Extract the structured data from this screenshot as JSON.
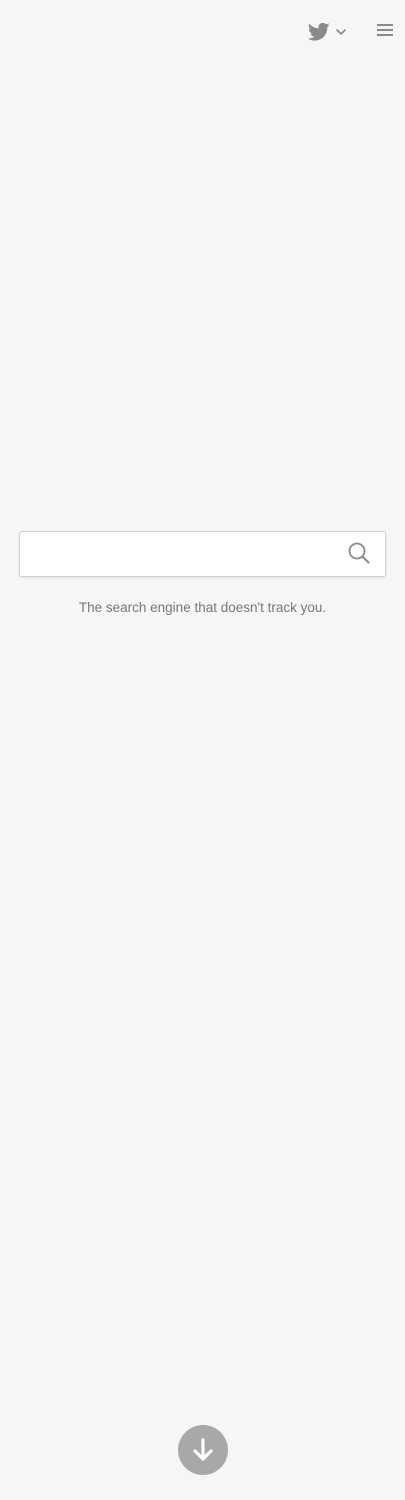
{
  "header": {
    "social_icon": "twitter-icon",
    "dropdown_icon": "chevron-down-icon",
    "menu_icon": "hamburger-menu-icon"
  },
  "search": {
    "value": "",
    "placeholder": "",
    "button_icon": "search-icon"
  },
  "tagline": "The search engine that doesn't track you.",
  "scroll_button": {
    "icon": "arrow-down-icon"
  },
  "colors": {
    "background": "#f6f6f6",
    "icon_gray": "#8a8a8a",
    "tagline_text": "#777777",
    "scroll_button_bg": "#a8a8a8",
    "search_border": "#cfcfcf"
  }
}
